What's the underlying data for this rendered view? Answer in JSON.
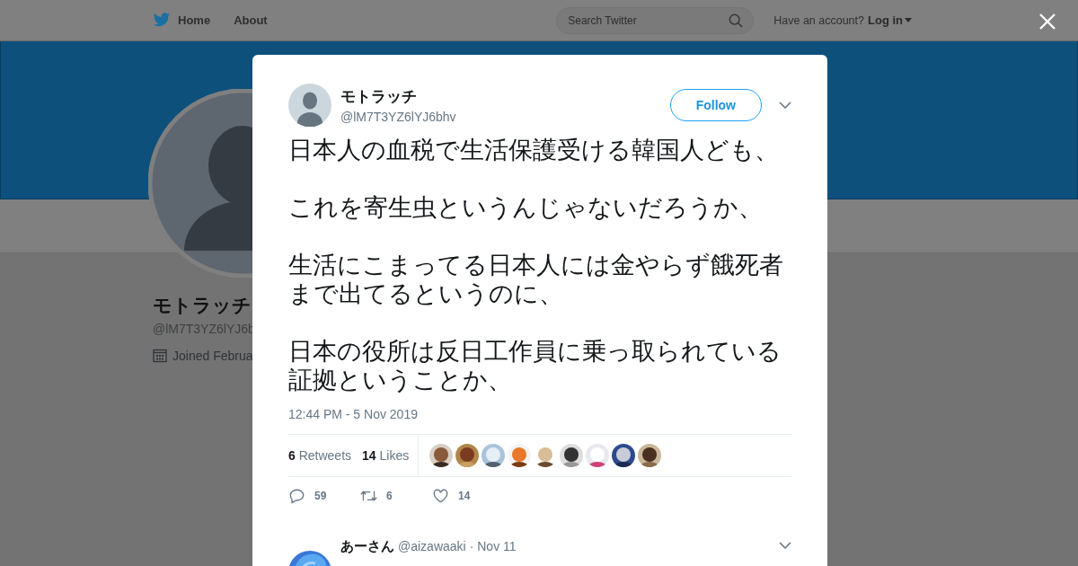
{
  "nav": {
    "links": [
      {
        "label": "Home",
        "kind": "logo"
      },
      {
        "label": "About"
      }
    ],
    "search": {
      "placeholder": "Search Twitter"
    },
    "account_prompt": "Have an account?",
    "login": "Log in"
  },
  "profile": {
    "name": "モトラッチ",
    "handle": "@lM7T3YZ6lYJ6b",
    "joined": "Joined Februa"
  },
  "tweet": {
    "name": "モトラッチ",
    "handle": "@lM7T3YZ6lYJ6bhv",
    "follow": "Follow",
    "paragraphs": [
      "日本人の血税で生活保護受ける韓国人ども、",
      "これを寄生虫というんじゃないだろうか、",
      "生活にこまってる日本人には金やらず餓死者まで出てるというのに、",
      "日本の役所は反日工作員に乗っ取られている証拠ということか、"
    ],
    "timestamp": "12:44 PM - 5 Nov 2019",
    "stats": [
      {
        "count": "6",
        "label": "Retweets"
      },
      {
        "count": "14",
        "label": "Likes"
      }
    ],
    "actions": [
      {
        "kind": "reply",
        "count": "59"
      },
      {
        "kind": "retweet",
        "count": "6"
      },
      {
        "kind": "like",
        "count": "14"
      }
    ]
  },
  "reply": {
    "name": "あーさん",
    "handle": "@aizawaaki",
    "date": "· Nov 11"
  }
}
